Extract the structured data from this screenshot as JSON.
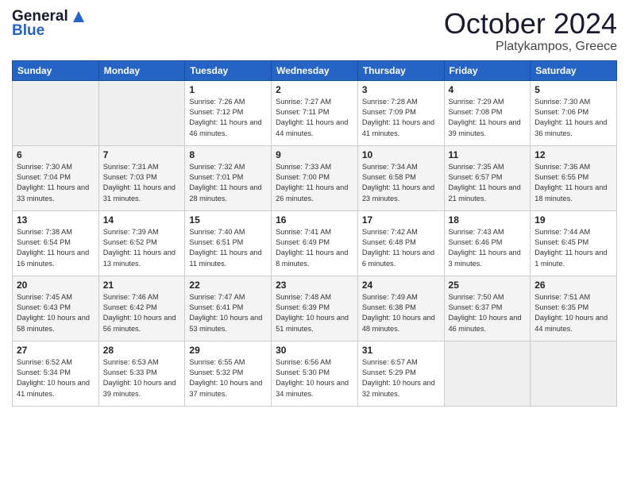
{
  "logo": {
    "line1": "General",
    "line2": "Blue"
  },
  "title": "October 2024",
  "location": "Platykampos, Greece",
  "weekdays": [
    "Sunday",
    "Monday",
    "Tuesday",
    "Wednesday",
    "Thursday",
    "Friday",
    "Saturday"
  ],
  "weeks": [
    [
      {
        "day": "",
        "sunrise": "",
        "sunset": "",
        "daylight": ""
      },
      {
        "day": "",
        "sunrise": "",
        "sunset": "",
        "daylight": ""
      },
      {
        "day": "1",
        "sunrise": "Sunrise: 7:26 AM",
        "sunset": "Sunset: 7:12 PM",
        "daylight": "Daylight: 11 hours and 46 minutes."
      },
      {
        "day": "2",
        "sunrise": "Sunrise: 7:27 AM",
        "sunset": "Sunset: 7:11 PM",
        "daylight": "Daylight: 11 hours and 44 minutes."
      },
      {
        "day": "3",
        "sunrise": "Sunrise: 7:28 AM",
        "sunset": "Sunset: 7:09 PM",
        "daylight": "Daylight: 11 hours and 41 minutes."
      },
      {
        "day": "4",
        "sunrise": "Sunrise: 7:29 AM",
        "sunset": "Sunset: 7:08 PM",
        "daylight": "Daylight: 11 hours and 39 minutes."
      },
      {
        "day": "5",
        "sunrise": "Sunrise: 7:30 AM",
        "sunset": "Sunset: 7:06 PM",
        "daylight": "Daylight: 11 hours and 36 minutes."
      }
    ],
    [
      {
        "day": "6",
        "sunrise": "Sunrise: 7:30 AM",
        "sunset": "Sunset: 7:04 PM",
        "daylight": "Daylight: 11 hours and 33 minutes."
      },
      {
        "day": "7",
        "sunrise": "Sunrise: 7:31 AM",
        "sunset": "Sunset: 7:03 PM",
        "daylight": "Daylight: 11 hours and 31 minutes."
      },
      {
        "day": "8",
        "sunrise": "Sunrise: 7:32 AM",
        "sunset": "Sunset: 7:01 PM",
        "daylight": "Daylight: 11 hours and 28 minutes."
      },
      {
        "day": "9",
        "sunrise": "Sunrise: 7:33 AM",
        "sunset": "Sunset: 7:00 PM",
        "daylight": "Daylight: 11 hours and 26 minutes."
      },
      {
        "day": "10",
        "sunrise": "Sunrise: 7:34 AM",
        "sunset": "Sunset: 6:58 PM",
        "daylight": "Daylight: 11 hours and 23 minutes."
      },
      {
        "day": "11",
        "sunrise": "Sunrise: 7:35 AM",
        "sunset": "Sunset: 6:57 PM",
        "daylight": "Daylight: 11 hours and 21 minutes."
      },
      {
        "day": "12",
        "sunrise": "Sunrise: 7:36 AM",
        "sunset": "Sunset: 6:55 PM",
        "daylight": "Daylight: 11 hours and 18 minutes."
      }
    ],
    [
      {
        "day": "13",
        "sunrise": "Sunrise: 7:38 AM",
        "sunset": "Sunset: 6:54 PM",
        "daylight": "Daylight: 11 hours and 16 minutes."
      },
      {
        "day": "14",
        "sunrise": "Sunrise: 7:39 AM",
        "sunset": "Sunset: 6:52 PM",
        "daylight": "Daylight: 11 hours and 13 minutes."
      },
      {
        "day": "15",
        "sunrise": "Sunrise: 7:40 AM",
        "sunset": "Sunset: 6:51 PM",
        "daylight": "Daylight: 11 hours and 11 minutes."
      },
      {
        "day": "16",
        "sunrise": "Sunrise: 7:41 AM",
        "sunset": "Sunset: 6:49 PM",
        "daylight": "Daylight: 11 hours and 8 minutes."
      },
      {
        "day": "17",
        "sunrise": "Sunrise: 7:42 AM",
        "sunset": "Sunset: 6:48 PM",
        "daylight": "Daylight: 11 hours and 6 minutes."
      },
      {
        "day": "18",
        "sunrise": "Sunrise: 7:43 AM",
        "sunset": "Sunset: 6:46 PM",
        "daylight": "Daylight: 11 hours and 3 minutes."
      },
      {
        "day": "19",
        "sunrise": "Sunrise: 7:44 AM",
        "sunset": "Sunset: 6:45 PM",
        "daylight": "Daylight: 11 hours and 1 minute."
      }
    ],
    [
      {
        "day": "20",
        "sunrise": "Sunrise: 7:45 AM",
        "sunset": "Sunset: 6:43 PM",
        "daylight": "Daylight: 10 hours and 58 minutes."
      },
      {
        "day": "21",
        "sunrise": "Sunrise: 7:46 AM",
        "sunset": "Sunset: 6:42 PM",
        "daylight": "Daylight: 10 hours and 56 minutes."
      },
      {
        "day": "22",
        "sunrise": "Sunrise: 7:47 AM",
        "sunset": "Sunset: 6:41 PM",
        "daylight": "Daylight: 10 hours and 53 minutes."
      },
      {
        "day": "23",
        "sunrise": "Sunrise: 7:48 AM",
        "sunset": "Sunset: 6:39 PM",
        "daylight": "Daylight: 10 hours and 51 minutes."
      },
      {
        "day": "24",
        "sunrise": "Sunrise: 7:49 AM",
        "sunset": "Sunset: 6:38 PM",
        "daylight": "Daylight: 10 hours and 48 minutes."
      },
      {
        "day": "25",
        "sunrise": "Sunrise: 7:50 AM",
        "sunset": "Sunset: 6:37 PM",
        "daylight": "Daylight: 10 hours and 46 minutes."
      },
      {
        "day": "26",
        "sunrise": "Sunrise: 7:51 AM",
        "sunset": "Sunset: 6:35 PM",
        "daylight": "Daylight: 10 hours and 44 minutes."
      }
    ],
    [
      {
        "day": "27",
        "sunrise": "Sunrise: 6:52 AM",
        "sunset": "Sunset: 5:34 PM",
        "daylight": "Daylight: 10 hours and 41 minutes."
      },
      {
        "day": "28",
        "sunrise": "Sunrise: 6:53 AM",
        "sunset": "Sunset: 5:33 PM",
        "daylight": "Daylight: 10 hours and 39 minutes."
      },
      {
        "day": "29",
        "sunrise": "Sunrise: 6:55 AM",
        "sunset": "Sunset: 5:32 PM",
        "daylight": "Daylight: 10 hours and 37 minutes."
      },
      {
        "day": "30",
        "sunrise": "Sunrise: 6:56 AM",
        "sunset": "Sunset: 5:30 PM",
        "daylight": "Daylight: 10 hours and 34 minutes."
      },
      {
        "day": "31",
        "sunrise": "Sunrise: 6:57 AM",
        "sunset": "Sunset: 5:29 PM",
        "daylight": "Daylight: 10 hours and 32 minutes."
      },
      {
        "day": "",
        "sunrise": "",
        "sunset": "",
        "daylight": ""
      },
      {
        "day": "",
        "sunrise": "",
        "sunset": "",
        "daylight": ""
      }
    ]
  ]
}
